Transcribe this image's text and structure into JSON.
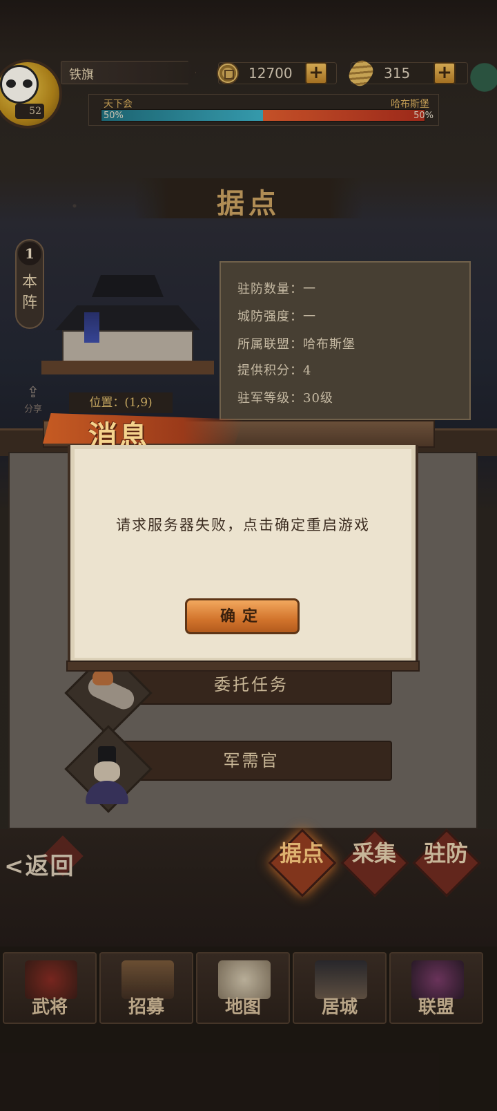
{
  "player": {
    "name": "铁旗",
    "level": "52"
  },
  "resources": {
    "gold": "12700",
    "gems": "315"
  },
  "faction_war": {
    "left_name": "天下会",
    "left_pct": "50%",
    "left_share": 0.5,
    "right_name": "哈布斯堡",
    "right_pct": "50%",
    "right_share": 0.5
  },
  "stronghold": {
    "title": "据点",
    "side_number": "1",
    "side_label": "本阵",
    "share_label": "分享",
    "position": "位置：(1,9)",
    "info": [
      "驻防数量：一",
      "城防强度：一",
      "所属联盟：哈布斯堡",
      "提供积分：4",
      "驻军等级：30级"
    ]
  },
  "tasks": [
    {
      "label": "委托任务"
    },
    {
      "label": "军需官"
    }
  ],
  "subnav": {
    "back_label": "返回",
    "tabs": [
      {
        "label": "据点"
      },
      {
        "label": "采集"
      },
      {
        "label": "驻防"
      }
    ]
  },
  "navbar": [
    {
      "label": "武将"
    },
    {
      "label": "招募"
    },
    {
      "label": "地图"
    },
    {
      "label": "居城"
    },
    {
      "label": "联盟"
    }
  ],
  "dialog": {
    "title": "消息",
    "message": "请求服务器失败，点击确定重启游戏",
    "ok_label": "确定"
  },
  "colors": {
    "accent": "#d2742c",
    "frame": "#3e2d21",
    "paper": "#ece3cf",
    "bar_left": "#3aa7bb",
    "bar_right": "#d5582c"
  }
}
